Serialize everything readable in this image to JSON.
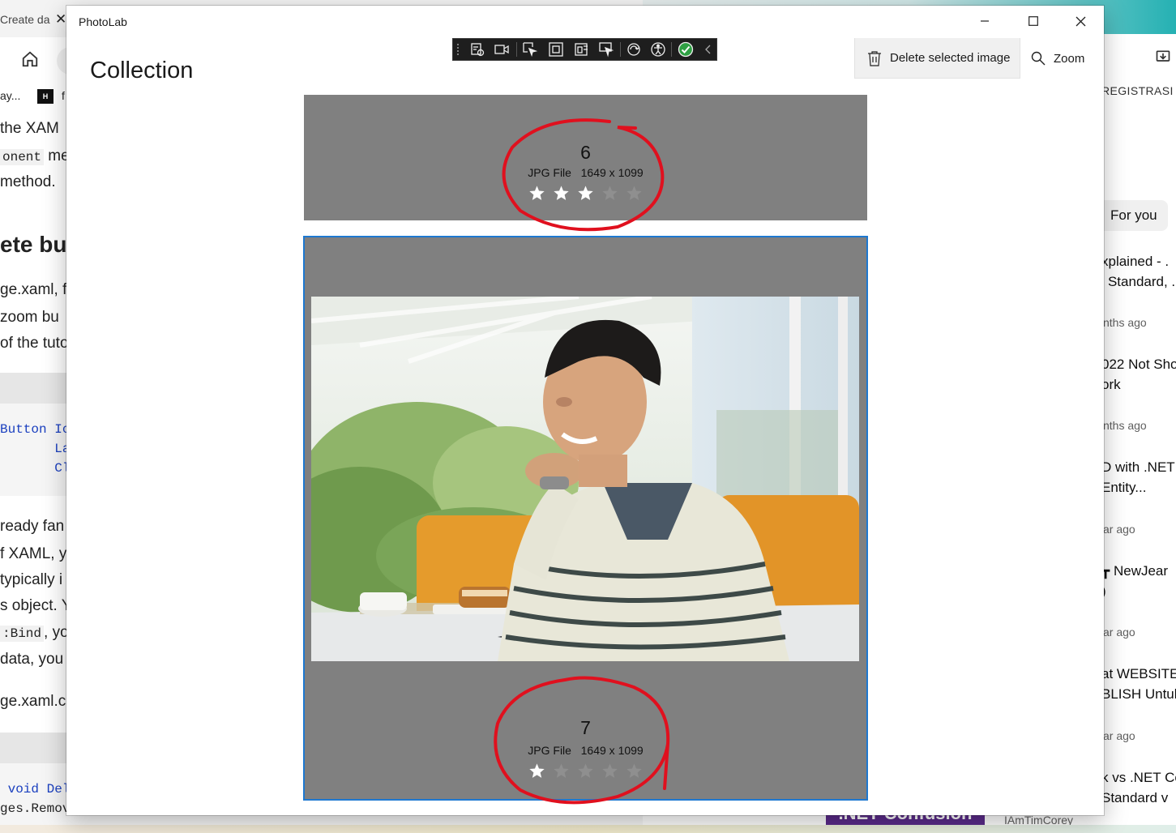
{
  "app": {
    "title": "PhotoLab",
    "page_title": "Collection"
  },
  "commands": {
    "delete_label": "Delete selected image",
    "zoom_label": "Zoom"
  },
  "images": [
    {
      "number": "6",
      "file_type": "JPG File",
      "dimensions": "1649 x 1099",
      "rating": 3,
      "max_rating": 5,
      "selected": false
    },
    {
      "number": "7",
      "file_type": "JPG File",
      "dimensions": "1649 x 1099",
      "rating": 1,
      "max_rating": 5,
      "selected": true
    }
  ],
  "colors": {
    "card_bg": "#808080",
    "selection_border": "#1e78d0",
    "annotation_ink": "#e0101e",
    "star_on": "#ffffff",
    "star_off": "#8f8f8f"
  },
  "background_left": {
    "tab_title": "Create da",
    "fav_text1": "ay...",
    "fav_text2": "f",
    "lines": [
      {
        "text": "the XAM"
      },
      {
        "code": "onent",
        "text": "met"
      },
      {
        "text": "method."
      },
      {
        "text": "ete but"
      },
      {
        "text": "ge.xaml, fi"
      },
      {
        "text": "zoom bu"
      },
      {
        "text": "of the tuto"
      },
      {
        "text": "ready fan"
      },
      {
        "text": "f XAML, y"
      },
      {
        "text": "typically i"
      },
      {
        "text": "s object. Y"
      },
      {
        "code": ":Bind",
        "text": ", yo"
      },
      {
        "text": "data, you"
      },
      {
        "text": "ge.xaml.cs"
      }
    ],
    "code_lines_1": [
      "Button Ic",
      "       La",
      "       Cl"
    ],
    "code_lines_2": [
      " void Del",
      "ges.Remov"
    ]
  },
  "background_right": {
    "reg_text": "REGISTRASI PE",
    "chip": "For you",
    "videos": [
      {
        "title_1": "xplained - .",
        "title_2": "' Standard, .",
        "meta": "nths ago"
      },
      {
        "title_1": "022 Not Sho",
        "title_2": "ork",
        "meta": "nths ago"
      },
      {
        "title_1": "D with .NET",
        "title_2": "Entity...",
        "meta": "ar ago"
      },
      {
        "title_1": "┳ NewJear",
        "title_2": ")",
        "meta": "ar ago"
      },
      {
        "title_1": "at WEBSITE",
        "title_2": "BLISH Untul",
        "meta": "ar ago"
      },
      {
        "title_1": "k vs .NET Co",
        "title_2": "Standard v",
        "meta": ""
      }
    ],
    "thumb_text": ".NET Confusion",
    "channel": "IAmTimCorey"
  }
}
